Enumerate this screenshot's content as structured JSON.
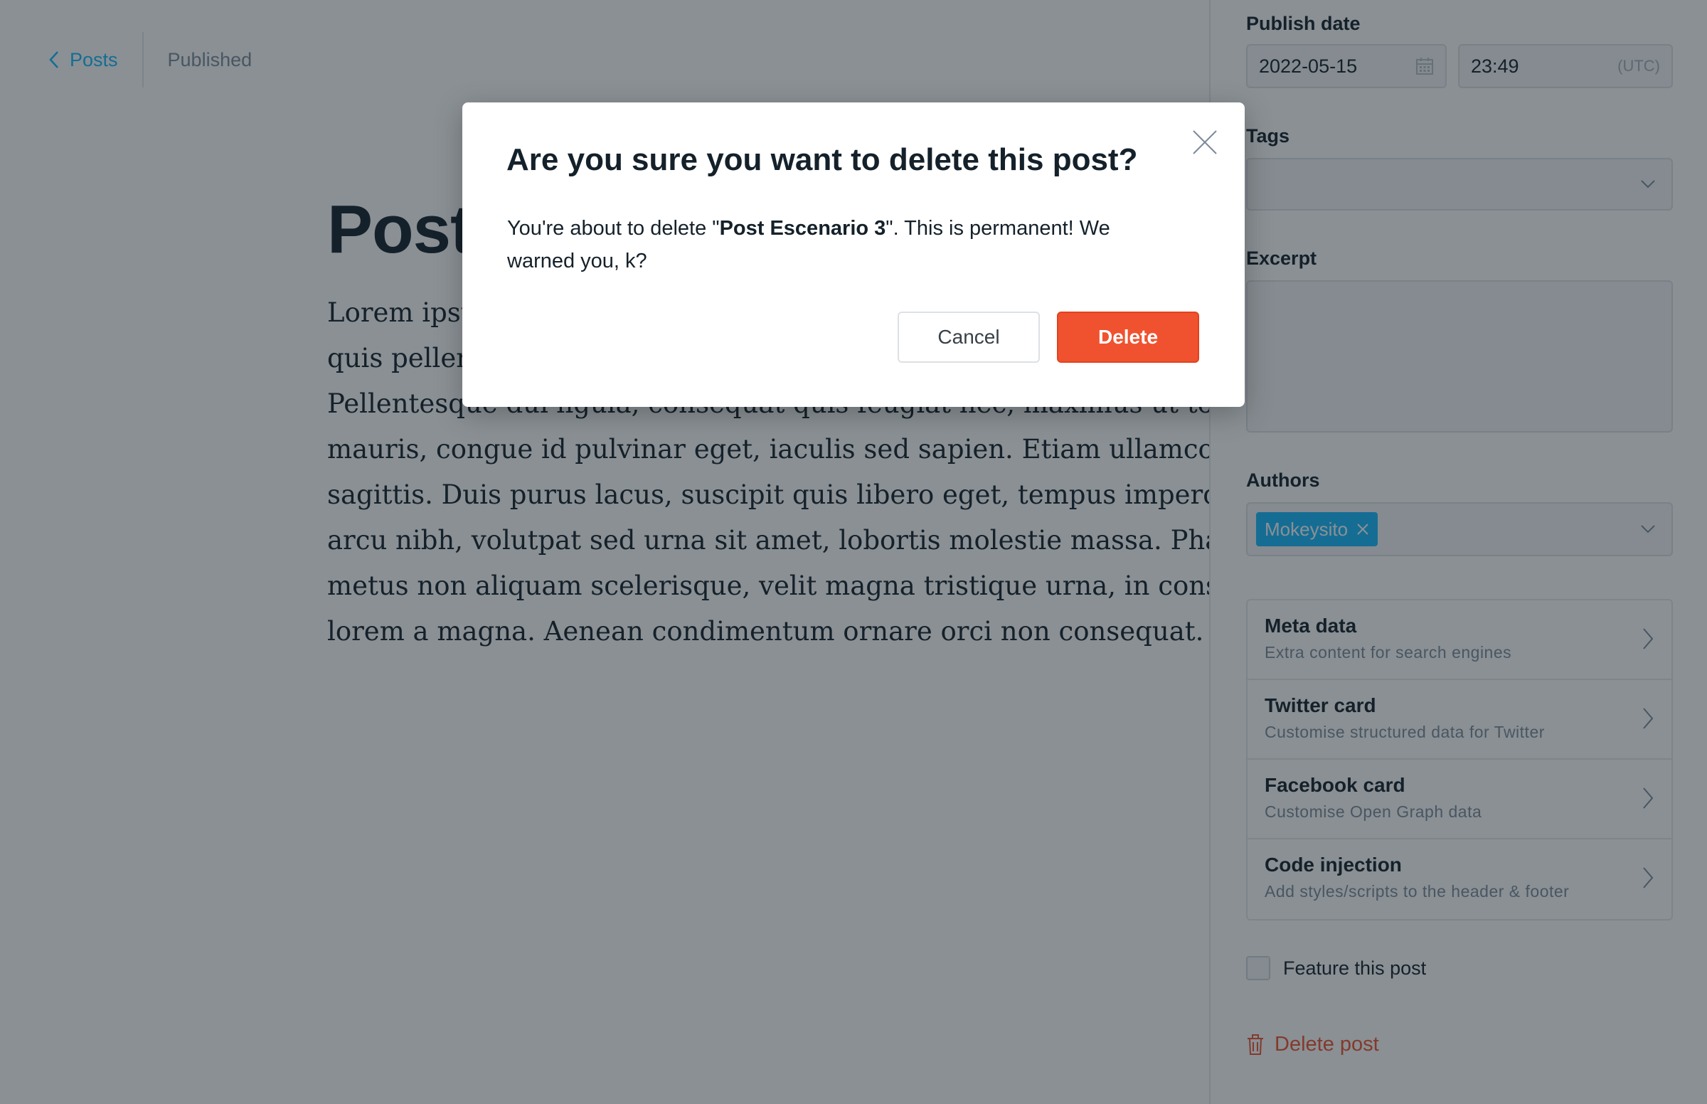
{
  "breadcrumb": {
    "back_label": "Posts",
    "status": "Published"
  },
  "editor": {
    "title": "Post",
    "body_lines": [
      "Lorem ipsu",
      "quis pellen",
      "Pellentesque dui ligula, consequat quis feugiat nec, maximus ut tortor",
      "mauris, congue id pulvinar eget, iaculis sed sapien. Etiam ullamcorper",
      "sagittis. Duis purus lacus, suscipit quis libero eget, tempus imperdiet n",
      "arcu nibh, volutpat sed urna sit amet, lobortis molestie massa. Phasell",
      "metus non aliquam scelerisque, velit magna tristique urna, in consequ",
      "lorem a magna. Aenean condimentum ornare orci non consequat."
    ]
  },
  "sidebar": {
    "publish_date": {
      "label": "Publish date",
      "date": "2022-05-15",
      "time": "23:49",
      "tz": "(UTC)"
    },
    "tags": {
      "label": "Tags"
    },
    "excerpt": {
      "label": "Excerpt"
    },
    "authors": {
      "label": "Authors",
      "chip": "Mokeysito"
    },
    "menu": [
      {
        "title": "Meta data",
        "subtitle": "Extra content for search engines"
      },
      {
        "title": "Twitter card",
        "subtitle": "Customise structured data for Twitter"
      },
      {
        "title": "Facebook card",
        "subtitle": "Customise Open Graph data"
      },
      {
        "title": "Code injection",
        "subtitle": "Add styles/scripts to the header & footer"
      }
    ],
    "feature_label": "Feature this post",
    "delete_label": "Delete post"
  },
  "modal": {
    "title": "Are you sure you want to delete this post?",
    "text_before": "You're about to delete \"",
    "post_name": "Post Escenario 3",
    "text_after": "\". This is permanent! We warned you, k?",
    "cancel_label": "Cancel",
    "delete_label": "Delete"
  },
  "colors": {
    "accent": "#14b8ff",
    "danger": "#f05230",
    "text": "#15212a",
    "muted": "#7c8b9a"
  }
}
